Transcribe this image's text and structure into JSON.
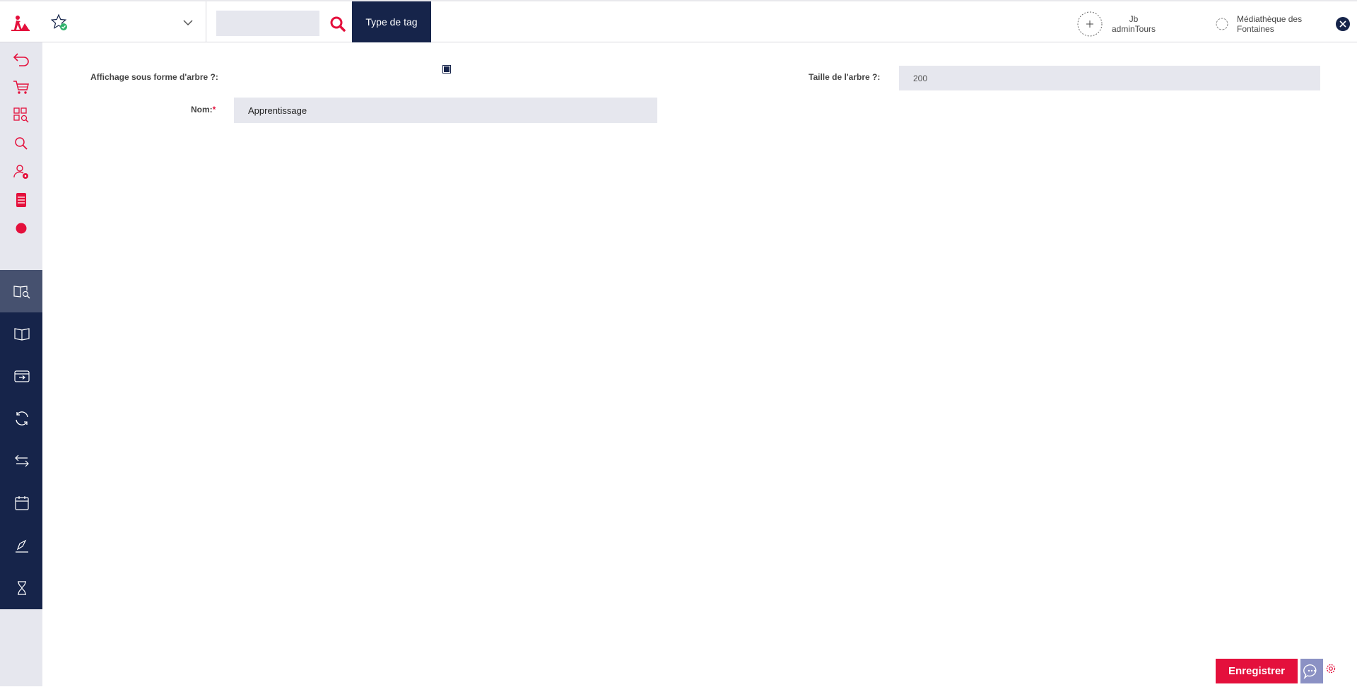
{
  "header": {
    "active_tab_label": "Type de tag",
    "search": {
      "value": "",
      "placeholder": ""
    },
    "user": {
      "line1": "Jb",
      "line2": "adminTours"
    },
    "library": {
      "line1": "Médiathèque des",
      "line2": "Fontaines"
    }
  },
  "sidebar": {
    "top_icons": [
      "back-arrow-icon",
      "cart-icon",
      "grid-search-icon",
      "search-icon",
      "user-settings-icon",
      "document-stack-icon",
      "record-icon"
    ],
    "dark_icons": [
      "book-search-icon",
      "open-book-icon",
      "inbox-transfer-icon",
      "refresh-icon",
      "swap-arrows-icon",
      "calendar-icon",
      "signature-icon",
      "hourglass-icon"
    ],
    "active_index": 0
  },
  "form": {
    "tree_display_label": "Affichage sous forme d'arbre ?:",
    "tree_display_checked": true,
    "tree_size_label": "Taille de l'arbre ?:",
    "tree_size_value": "200",
    "name_label": "Nom:",
    "name_required_mark": "*",
    "name_value": "Apprentissage"
  },
  "footer": {
    "save_label": "Enregistrer"
  },
  "colors": {
    "navy": "#16244a",
    "accent": "#e4103c",
    "field_bg": "#e6e7ee",
    "chat": "#8b91c4"
  }
}
